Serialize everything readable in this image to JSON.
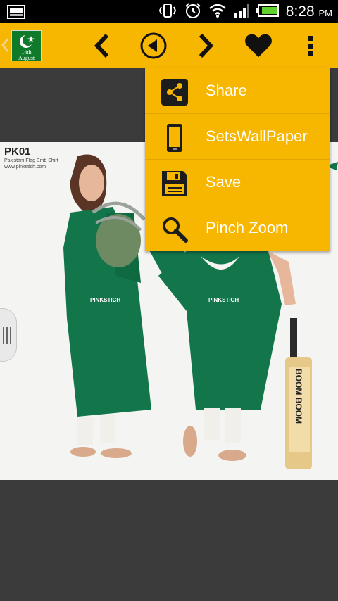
{
  "status_bar": {
    "time": "8:28",
    "ampm": "PM"
  },
  "app_logo": {
    "line1": "14th",
    "line2": "August"
  },
  "menu": {
    "items": [
      {
        "label": "Share",
        "icon": "share-icon"
      },
      {
        "label": "SetsWallPaper",
        "icon": "phone-icon"
      },
      {
        "label": "Save",
        "icon": "floppy-disk-icon"
      },
      {
        "label": "Pinch Zoom",
        "icon": "magnifier-icon"
      }
    ]
  },
  "photo": {
    "product_code": "PK01",
    "subtitle": "Pakistani Flag Emb Shirt",
    "website": "www.pinkstich.com",
    "brand_print": "PINKSTICH",
    "bat_print": "BOOM BOOM"
  },
  "colors": {
    "action_bar": "#f7b600",
    "background": "#3b3b3b",
    "kurta_green": "#13754a"
  }
}
